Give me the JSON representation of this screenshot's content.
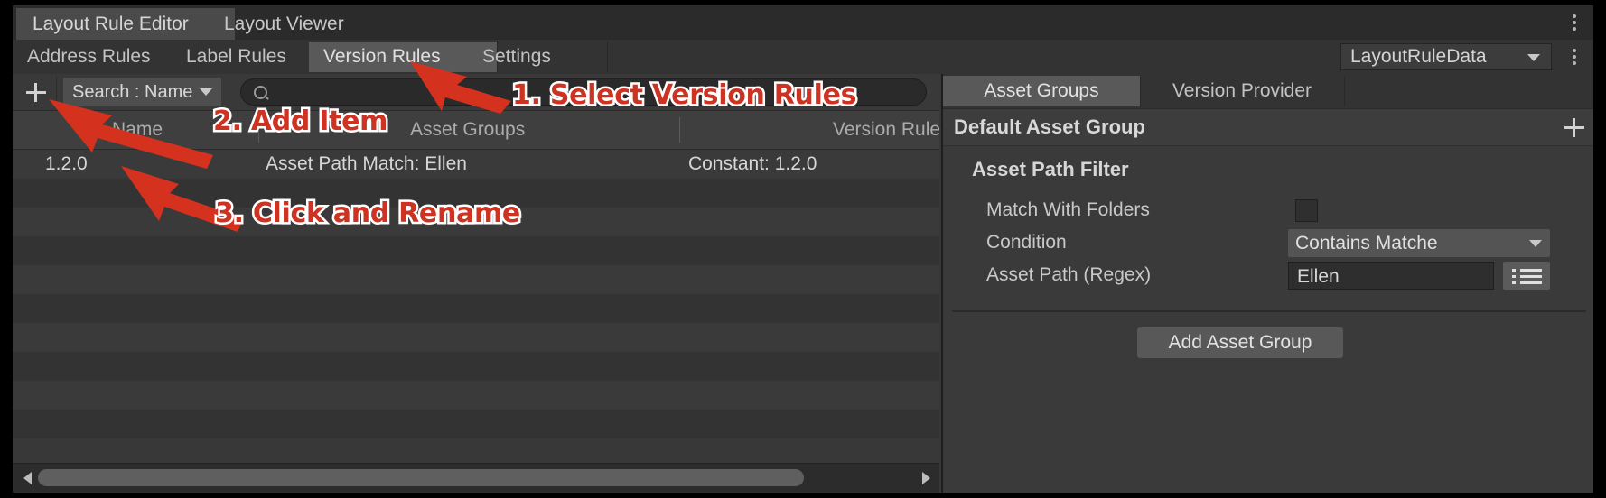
{
  "window": {
    "tabs": [
      {
        "label": "Layout Rule Editor",
        "active": true
      },
      {
        "label": "Layout Viewer",
        "active": false
      }
    ],
    "menu_icon": "kebab-menu-icon"
  },
  "rule_tabs": {
    "items": [
      {
        "label": "Address Rules",
        "active": false
      },
      {
        "label": "Label Rules",
        "active": false
      },
      {
        "label": "Version Rules",
        "active": true
      },
      {
        "label": "Settings",
        "active": false
      }
    ],
    "asset_picker": {
      "value": "LayoutRuleData",
      "caret_icon": "chevron-down-icon"
    },
    "menu_icon": "kebab-menu-icon"
  },
  "toolbar": {
    "add_icon": "plus-icon",
    "search_mode": {
      "label": "Search : Name",
      "caret_icon": "chevron-down-icon"
    },
    "search": {
      "icon": "search-icon",
      "value": "",
      "placeholder": ""
    }
  },
  "table": {
    "columns": [
      {
        "label": "Name"
      },
      {
        "label": "Asset Groups"
      },
      {
        "label": "Version Rule"
      }
    ],
    "rows": [
      {
        "name": "1.2.0",
        "asset_groups": "Asset Path Match: Ellen",
        "version_rule": "Constant: 1.2.0"
      }
    ],
    "empty_row_count": 9,
    "scrollbar": {
      "left_arrow_icon": "chevron-left-icon",
      "right_arrow_icon": "chevron-right-icon"
    }
  },
  "inspector": {
    "tabs": [
      {
        "label": "Asset Groups",
        "active": true
      },
      {
        "label": "Version Provider",
        "active": false
      }
    ],
    "group": {
      "title": "Default Asset Group",
      "add_icon": "plus-icon",
      "section_title": "Asset Path Filter",
      "fields": [
        {
          "label": "Match With Folders",
          "type": "checkbox",
          "value": false
        },
        {
          "label": "Condition",
          "type": "dropdown",
          "value": "Contains Matche",
          "caret_icon": "chevron-down-icon"
        },
        {
          "label": "Asset Path (Regex)",
          "type": "text",
          "value": "Ellen",
          "button_icon": "list-icon"
        }
      ]
    },
    "add_group_button": "Add Asset Group"
  },
  "annotations": {
    "accent_color": "#CC3322",
    "outline_color": "#FFFFFF",
    "items": [
      {
        "text": "1. Select Version Rules"
      },
      {
        "text": "2. Add Item"
      },
      {
        "text": "3. Click and Rename"
      }
    ]
  }
}
